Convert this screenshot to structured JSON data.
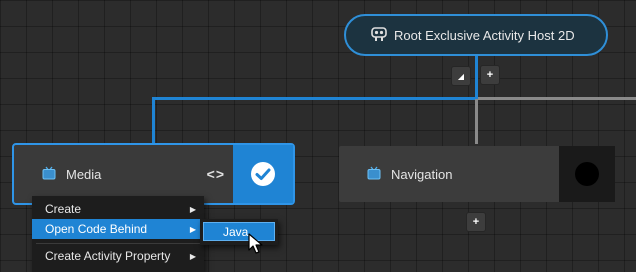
{
  "root_node": {
    "label": "Root Exclusive Activity Host 2D",
    "icon": "robot-icon"
  },
  "root_controls": {
    "collapse_label": "◢",
    "add_label": "+"
  },
  "media_node": {
    "label": "Media",
    "code_symbol": "<>",
    "icon": "tv-icon",
    "status_icon": "check-circle-icon"
  },
  "navigation_node": {
    "label": "Navigation",
    "icon": "tv-icon",
    "status_icon": "circle-icon"
  },
  "navigation_add": {
    "label": "+"
  },
  "context_menu": {
    "items": [
      {
        "label": "Create",
        "has_submenu": true
      },
      {
        "label": "Open Code Behind",
        "has_submenu": true,
        "active": true
      },
      {
        "label": "Create Activity Property",
        "has_submenu": true
      }
    ],
    "arrow": "▶"
  },
  "submenu": {
    "items": [
      {
        "label": "Java"
      }
    ]
  },
  "colors": {
    "accent": "#1f84d4",
    "node_bg": "#3a3a3a",
    "canvas_bg": "#2c2c2c",
    "menu_bg": "#1d1d1d"
  }
}
